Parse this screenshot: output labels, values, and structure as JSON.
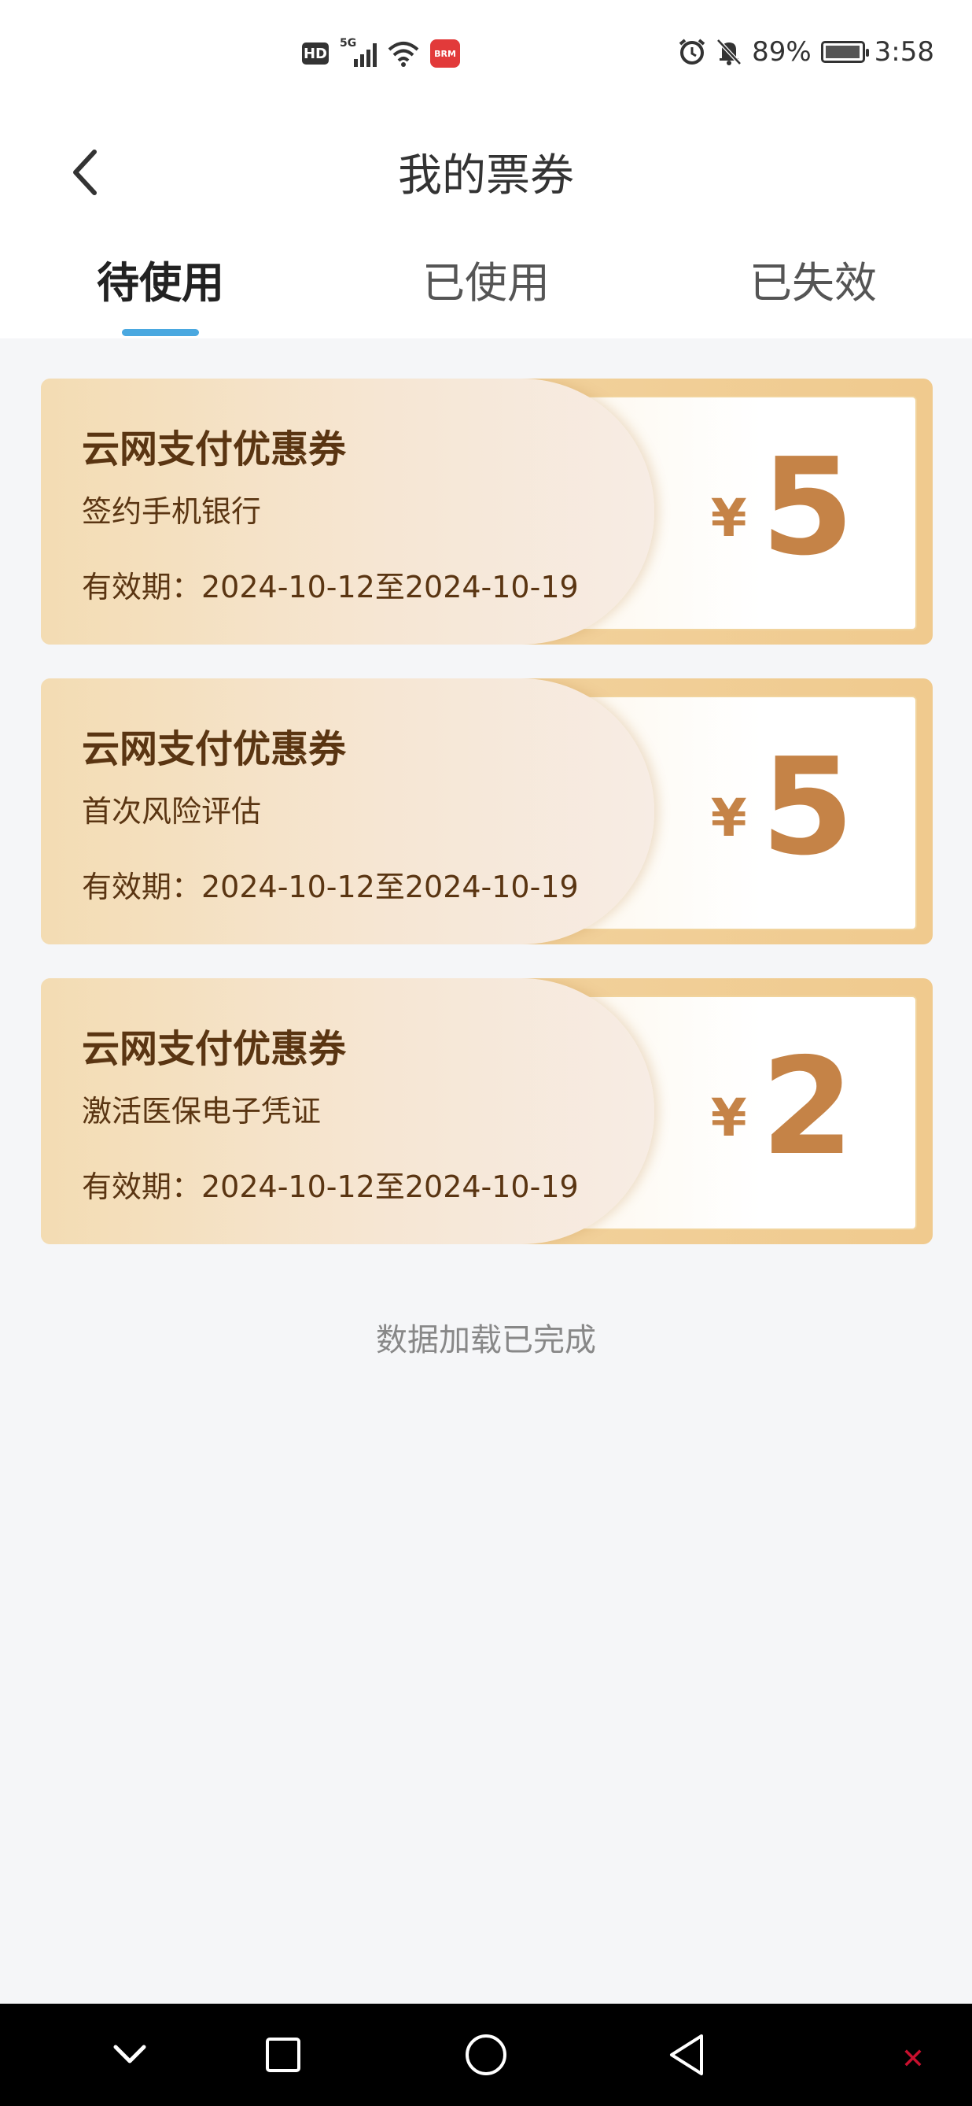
{
  "status_bar": {
    "hd": "HD",
    "network": "5G",
    "app_badge": "BRM",
    "battery": "89%",
    "time": "3:58"
  },
  "header": {
    "title": "我的票券",
    "tabs": [
      {
        "label": "待使用",
        "active": true
      },
      {
        "label": "已使用",
        "active": false
      },
      {
        "label": "已失效",
        "active": false
      }
    ]
  },
  "coupons": [
    {
      "title": "云网支付优惠券",
      "desc": "签约手机银行",
      "validity": "有效期：2024-10-12至2024-10-19",
      "currency": "¥",
      "amount": "5"
    },
    {
      "title": "云网支付优惠券",
      "desc": "首次风险评估",
      "validity": "有效期：2024-10-12至2024-10-19",
      "currency": "¥",
      "amount": "5"
    },
    {
      "title": "云网支付优惠券",
      "desc": "激活医保电子凭证",
      "validity": "有效期：2024-10-12至2024-10-19",
      "currency": "¥",
      "amount": "2"
    }
  ],
  "load_status": "数据加载已完成",
  "colors": {
    "accent": "#4aa8e0",
    "coupon_gold": "#f0ca8e",
    "amount": "#c58347",
    "coupon_text": "#5a3512"
  }
}
